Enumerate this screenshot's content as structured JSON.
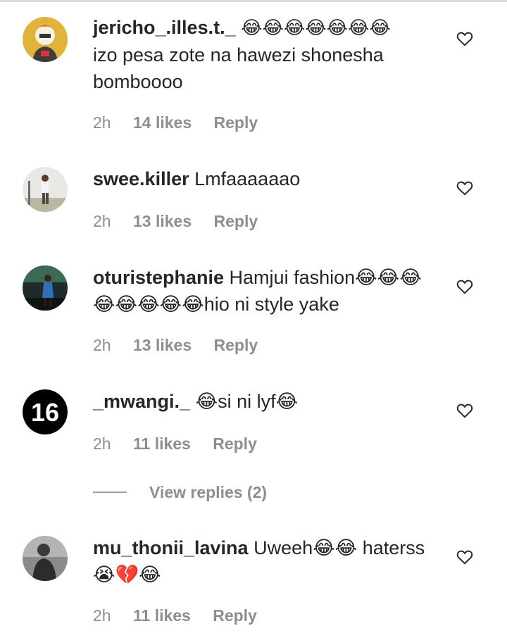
{
  "comments": [
    {
      "username": "jericho_.illes.t._",
      "text": "😂😂😂😂😂😂😂 izo pesa zote na hawezi shonesha bomboooo",
      "time": "2h",
      "likes": "14 likes",
      "reply": "Reply",
      "avatar_icon": "cartoon-avatar",
      "heart_icon": "heart-outline-icon"
    },
    {
      "username": "swee.killer",
      "text": "Lmfaaaaaao",
      "time": "2h",
      "likes": "13 likes",
      "reply": "Reply",
      "avatar_icon": "person-photo-avatar",
      "heart_icon": "heart-outline-icon"
    },
    {
      "username": "oturistephanie",
      "text": "Hamjui fashion😂😂😂😂😂😂😂😂hio ni style yake",
      "time": "2h",
      "likes": "13 likes",
      "reply": "Reply",
      "avatar_icon": "dark-photo-avatar",
      "heart_icon": "heart-outline-icon"
    },
    {
      "username": "_mwangi._",
      "text": "😂si ni lyf😂",
      "time": "2h",
      "likes": "11 likes",
      "reply": "Reply",
      "avatar_icon": "number-16-avatar",
      "avatar_text": "16",
      "heart_icon": "heart-outline-icon"
    },
    {
      "username": "mu_thonii_lavina",
      "text": "Uweeh😂😂 haterss 😭💔😂",
      "time": "2h",
      "likes": "11 likes",
      "reply": "Reply",
      "avatar_icon": "grey-photo-avatar",
      "heart_icon": "heart-outline-icon"
    }
  ],
  "view_replies": {
    "label": "View replies (2)"
  }
}
